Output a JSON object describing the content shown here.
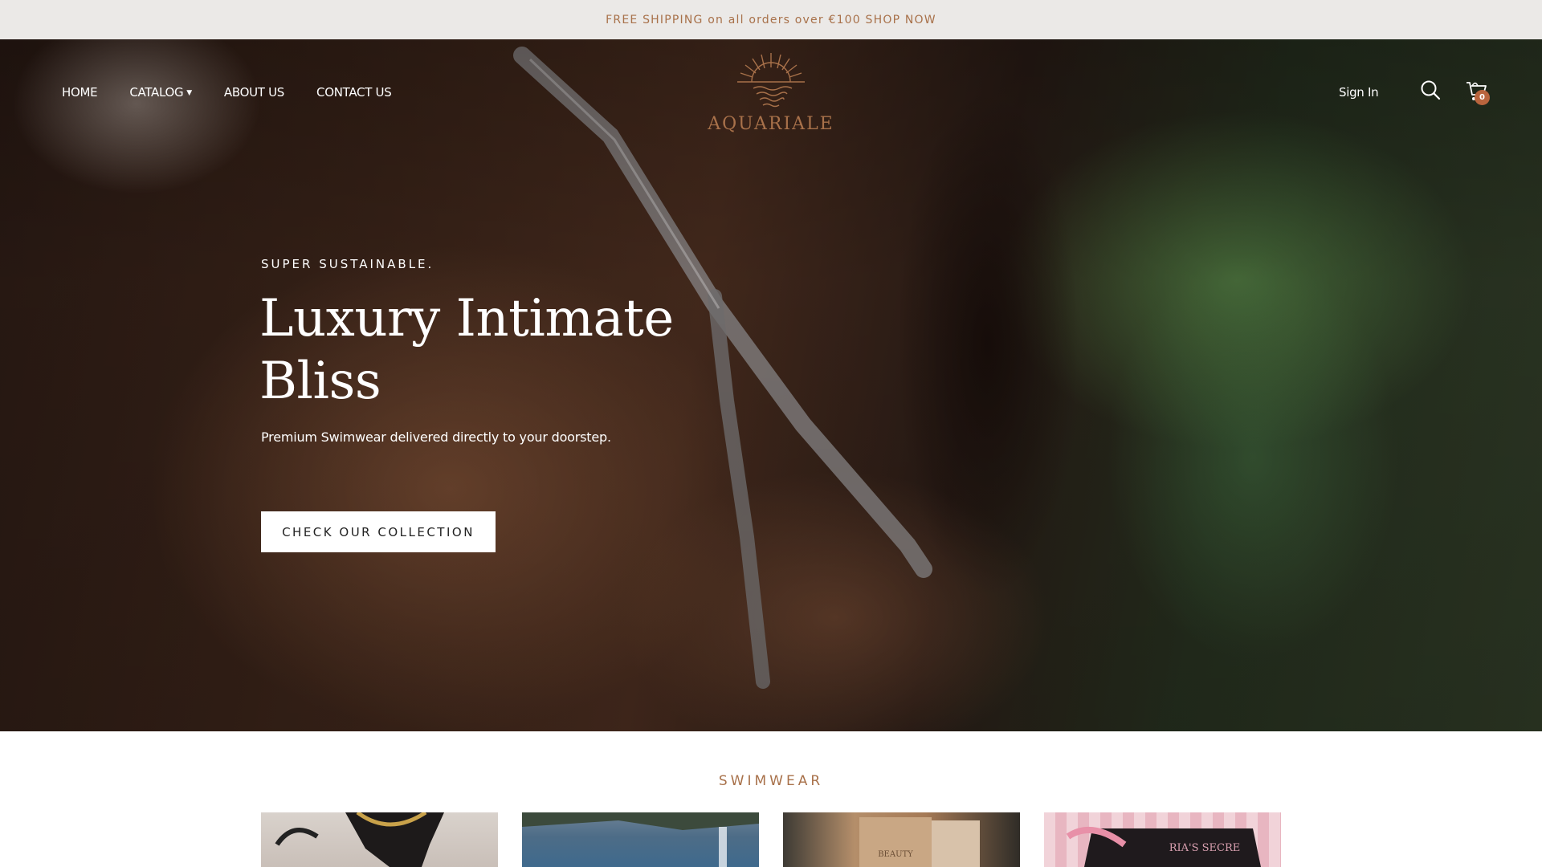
{
  "announcement": {
    "text": "FREE SHIPPING on all orders over €100 SHOP NOW"
  },
  "header": {
    "nav": [
      {
        "label": "HOME"
      },
      {
        "label": "CATALOG",
        "has_dropdown": true
      },
      {
        "label": "ABOUT US"
      },
      {
        "label": "CONTACT US"
      }
    ],
    "logo_text": "AQUARIALE",
    "sign_in": "Sign In",
    "cart_count": "0",
    "icons": [
      "search-icon",
      "cart-icon",
      "sunrise-logo-icon"
    ]
  },
  "hero": {
    "eyebrow": "SUPER SUSTAINABLE.",
    "headline": "Luxury Intimate Bliss",
    "subtext": "Premium Swimwear delivered directly to your doorstep.",
    "cta_label": "CHECK OUR COLLECTION"
  },
  "section": {
    "title": "SWIMWEAR",
    "cards": [
      {
        "name": "swimwear-card-1"
      },
      {
        "name": "swimwear-card-2"
      },
      {
        "name": "swimwear-card-3"
      },
      {
        "name": "swimwear-card-4"
      }
    ]
  },
  "colors": {
    "accent": "#a8714a",
    "announcement_bg": "#ebe9e7",
    "badge": "#b9643d"
  }
}
